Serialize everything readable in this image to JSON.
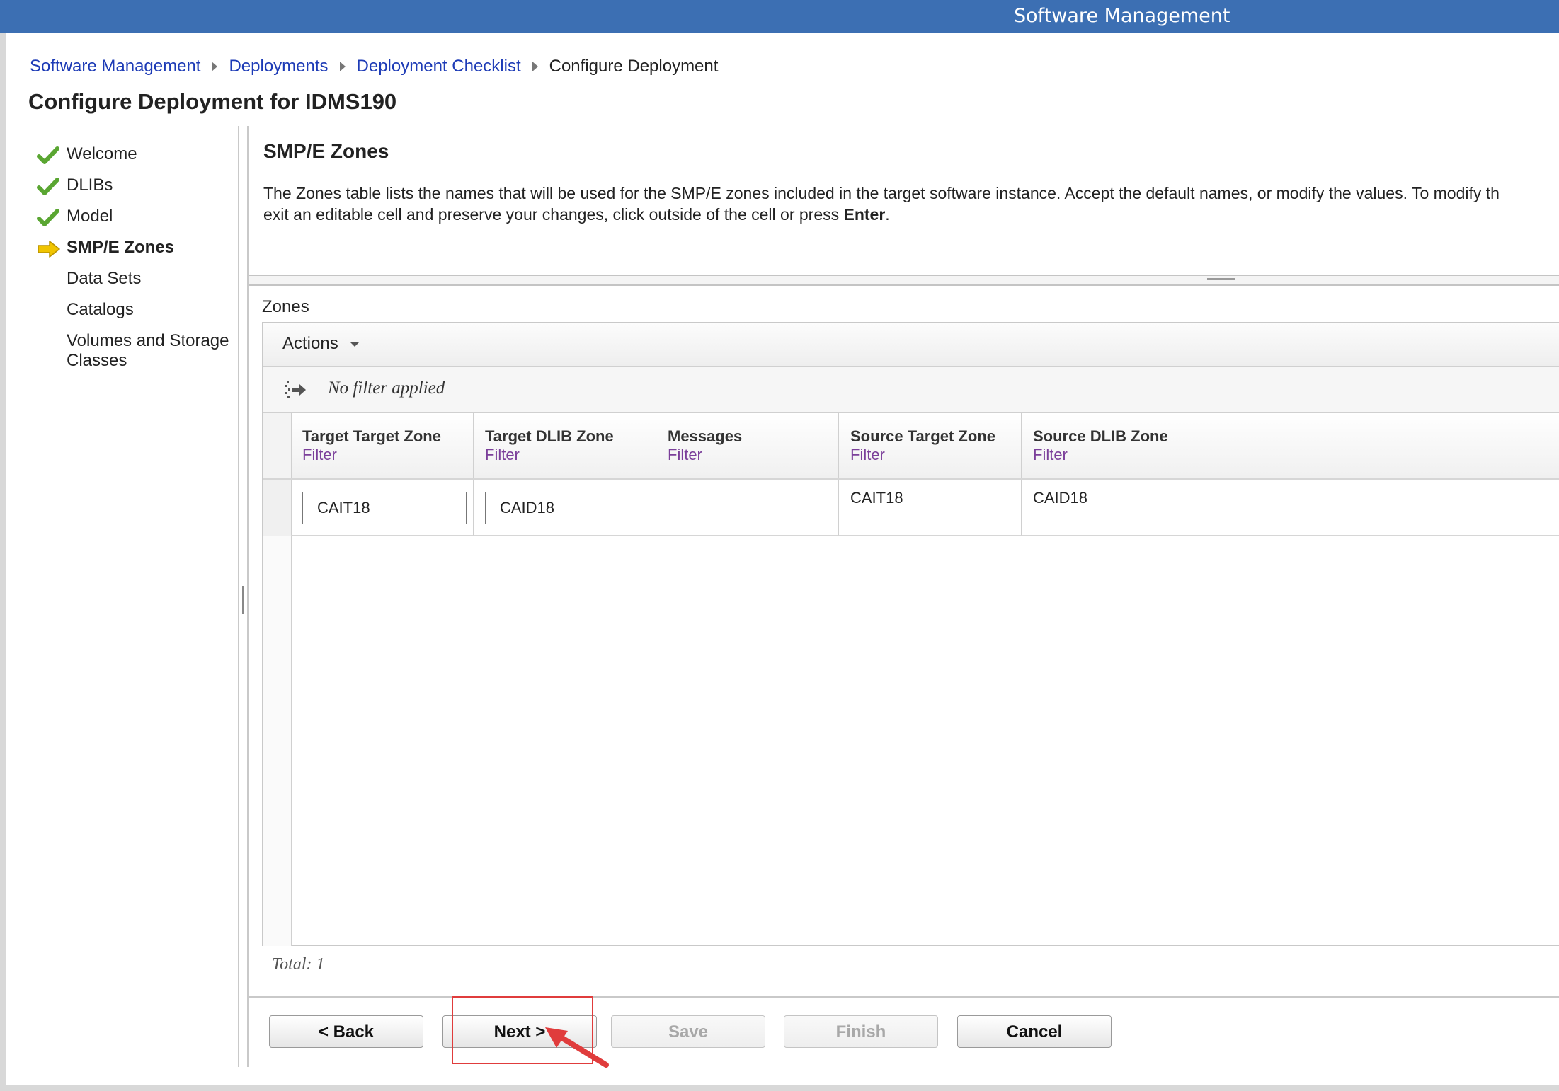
{
  "app": {
    "title": "Software Management"
  },
  "breadcrumb": [
    {
      "label": "Software Management"
    },
    {
      "label": "Deployments"
    },
    {
      "label": "Deployment Checklist"
    },
    {
      "label": "Configure Deployment"
    }
  ],
  "page": {
    "title": "Configure Deployment for IDMS190"
  },
  "steps": [
    {
      "label": "Welcome",
      "status": "complete"
    },
    {
      "label": "DLIBs",
      "status": "complete"
    },
    {
      "label": "Model",
      "status": "complete"
    },
    {
      "label": "SMP/E Zones",
      "status": "current"
    },
    {
      "label": "Data Sets",
      "status": "pending"
    },
    {
      "label": "Catalogs",
      "status": "pending"
    },
    {
      "label": "Volumes and Storage Classes",
      "status": "pending"
    }
  ],
  "section": {
    "title": "SMP/E Zones",
    "desc_line1": "The Zones table lists the names that will be used for the SMP/E zones included in the target software instance.  Accept the default names, or modify the values. To modify th",
    "desc_line2_pre": "exit an editable cell and preserve your changes, click outside of the cell or press ",
    "desc_line2_bold": "Enter",
    "desc_line2_post": "."
  },
  "zones": {
    "label": "Zones",
    "actions_label": "Actions",
    "filter_status": "No filter applied",
    "filter_link": "Filter",
    "columns": [
      "Target Target Zone",
      "Target DLIB Zone",
      "Messages",
      "Source Target Zone",
      "Source DLIB Zone"
    ],
    "rows": [
      {
        "target_target_zone": "CAIT18",
        "target_dlib_zone": "CAID18",
        "messages": "",
        "source_target_zone": "CAIT18",
        "source_dlib_zone": "CAID18"
      }
    ],
    "total": "Total: 1"
  },
  "buttons": {
    "back": "< Back",
    "next": "Next >",
    "save": "Save",
    "finish": "Finish",
    "cancel": "Cancel"
  },
  "colors": {
    "header": "#3c6fb3",
    "link": "#1d3bb6",
    "filter_link": "#7b3f9a",
    "check": "#5aa632",
    "current_arrow": "#f0c400",
    "annotation": "#e03c3c"
  }
}
